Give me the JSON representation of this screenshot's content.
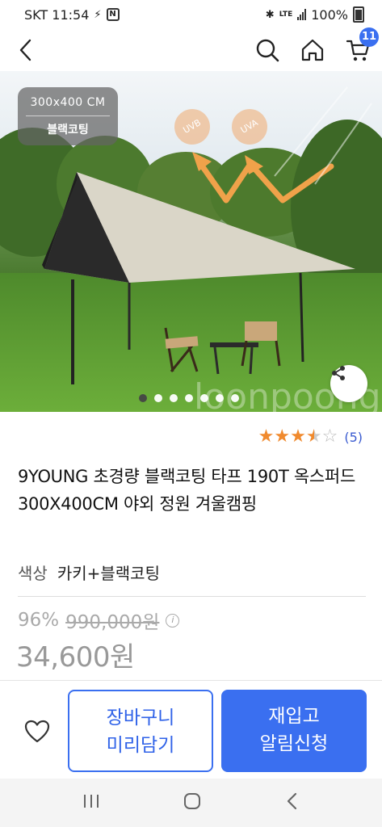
{
  "status_bar": {
    "carrier_time": "SKT 11:54",
    "network": "LTE",
    "battery": "100%"
  },
  "header": {
    "cart_count": "11"
  },
  "hero": {
    "size_label": "300x400 CM",
    "coating_label": "블랙코팅",
    "uvb": "UVB",
    "uva": "UVA",
    "watermark": "loonpoongrg",
    "image_count": 7,
    "active_image": 1
  },
  "rating": {
    "value": 3.5,
    "max": 5,
    "count": "(5)",
    "star_color": "#f08a2e"
  },
  "product": {
    "title": "9YOUNG 초경량 블랙코팅 타프 190T 옥스퍼드 300X400CM 야외 정원 겨울캠핑",
    "option_label": "색상",
    "option_value": "카키+블랙코팅",
    "discount": "96%",
    "original_price": "990,000원",
    "sale_price": "34,600원"
  },
  "actions": {
    "cart_line1": "장바구니",
    "cart_line2": "미리담기",
    "restock_line1": "재입고",
    "restock_line2": "알림신청",
    "accent": "#3a6ff0"
  },
  "icons": [
    "back-icon",
    "search-icon",
    "home-icon",
    "cart-icon",
    "share-icon",
    "heart-icon",
    "info-icon",
    "recent-apps-icon",
    "home-nav-icon",
    "back-nav-icon"
  ]
}
